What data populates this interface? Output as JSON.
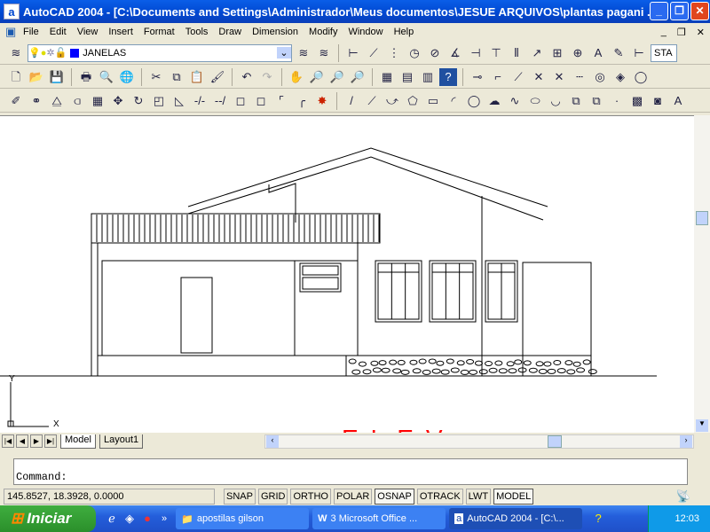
{
  "window": {
    "title": "AutoCAD 2004 - [C:\\Documents and Settings\\Administrador\\Meus documentos\\JESUE ARQUIVOS\\plantas pagani ..."
  },
  "menu": [
    "File",
    "Edit",
    "View",
    "Insert",
    "Format",
    "Tools",
    "Draw",
    "Dimension",
    "Modify",
    "Window",
    "Help"
  ],
  "layer": {
    "name": "JANELAS",
    "color": "#0000ff"
  },
  "style_box": "STA",
  "drawing": {
    "title_text": "ELEV. FRONTAL",
    "title_color": "#ff0000",
    "ucs_x": "X",
    "ucs_y": "Y"
  },
  "tabs": [
    {
      "label": "Model",
      "active": true
    },
    {
      "label": "Layout1",
      "active": false
    }
  ],
  "command": {
    "prompt": "Command:"
  },
  "status": {
    "coords": "145.8527, 18.3928, 0.0000",
    "buttons": [
      {
        "label": "SNAP",
        "on": false
      },
      {
        "label": "GRID",
        "on": false
      },
      {
        "label": "ORTHO",
        "on": false
      },
      {
        "label": "POLAR",
        "on": false
      },
      {
        "label": "OSNAP",
        "on": true
      },
      {
        "label": "OTRACK",
        "on": false
      },
      {
        "label": "LWT",
        "on": false
      },
      {
        "label": "MODEL",
        "on": true
      }
    ]
  },
  "taskbar": {
    "start": "Iniciar",
    "tasks": [
      {
        "label": "apostilas gilson",
        "icon": "folder-icon"
      },
      {
        "label": "3 Microsoft Office ...",
        "icon": "word-icon"
      },
      {
        "label": "AutoCAD 2004 - [C:\\...",
        "icon": "autocad-icon"
      }
    ],
    "clock": "12:03"
  }
}
